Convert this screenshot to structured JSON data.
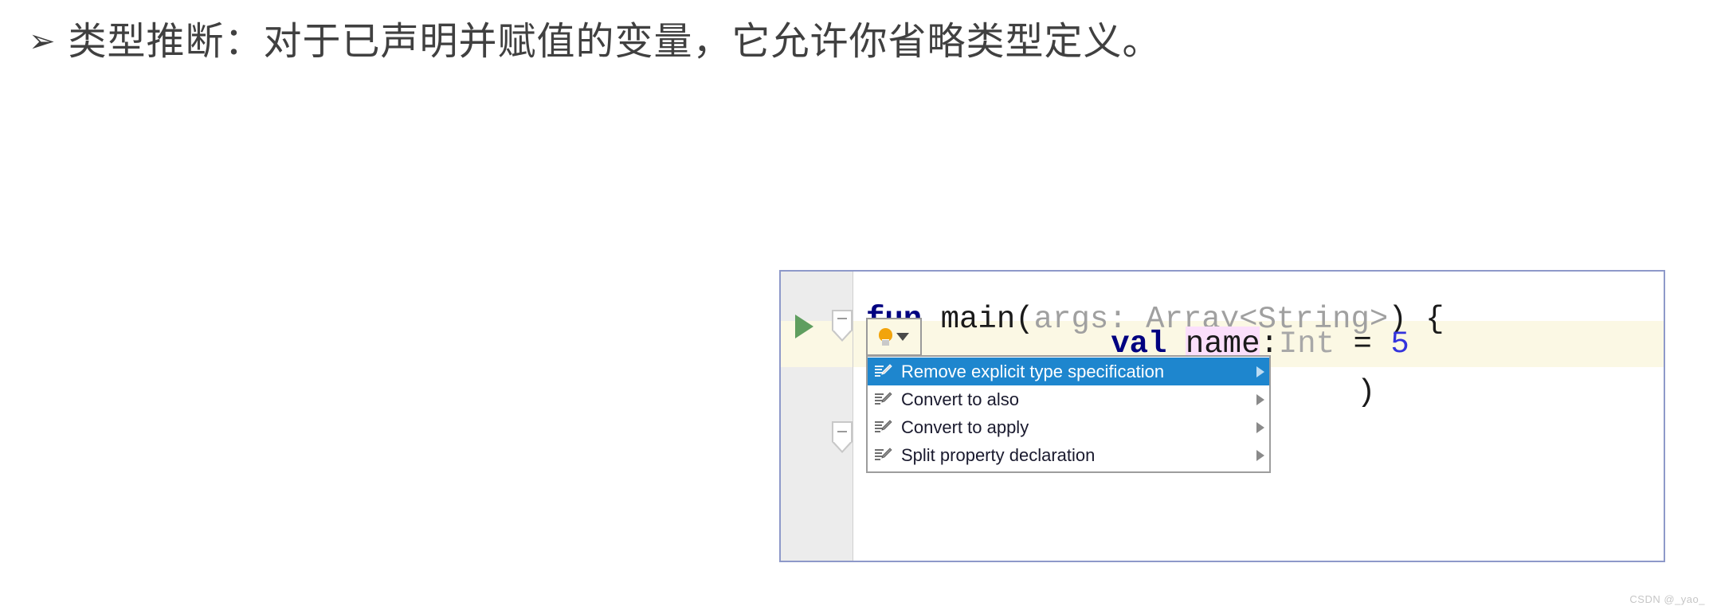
{
  "slide": {
    "bullet_glyph": "➢",
    "heading": "类型推断：对于已声明并赋值的变量，它允许你省略类型定义。"
  },
  "editor": {
    "gutter": {
      "run_icon": "run-arrow-icon",
      "fold_icon_top": "fold-collapse-icon",
      "fold_icon_bottom": "fold-collapse-icon"
    },
    "intention_button": {
      "icon": "lightbulb-icon",
      "caret": "chevron-down-icon"
    },
    "code": {
      "line1": {
        "kw": "fun",
        "fn": " main",
        "paren_open": "(",
        "params": "args: Array<String>",
        "paren_close": ")",
        "brace": " {"
      },
      "line2": {
        "kw": "val",
        "ident": "name",
        "colon": ":",
        "type": "Int",
        "eq": " = ",
        "value": "5"
      },
      "line3_visible": ")"
    },
    "colors": {
      "keyword": "#000080",
      "number": "#3333dd",
      "grayed_type": "#a8a8a8",
      "ident_highlight_bg": "#fbdffb",
      "current_line_bg": "#fbf8e4",
      "panel_border": "#8e99c9",
      "gutter_bg": "#ececec",
      "menu_selected_bg": "#1e86ce"
    }
  },
  "intention_menu": {
    "items": [
      {
        "label": "Remove explicit type specification",
        "icon": "quickfix-icon",
        "selected": true,
        "has_submenu": true
      },
      {
        "label": "Convert to also",
        "icon": "quickfix-icon",
        "selected": false,
        "has_submenu": true
      },
      {
        "label": "Convert to apply",
        "icon": "quickfix-icon",
        "selected": false,
        "has_submenu": true
      },
      {
        "label": "Split property declaration",
        "icon": "quickfix-icon",
        "selected": false,
        "has_submenu": true
      }
    ]
  },
  "watermark": {
    "text": "CSDN @_yao_"
  }
}
